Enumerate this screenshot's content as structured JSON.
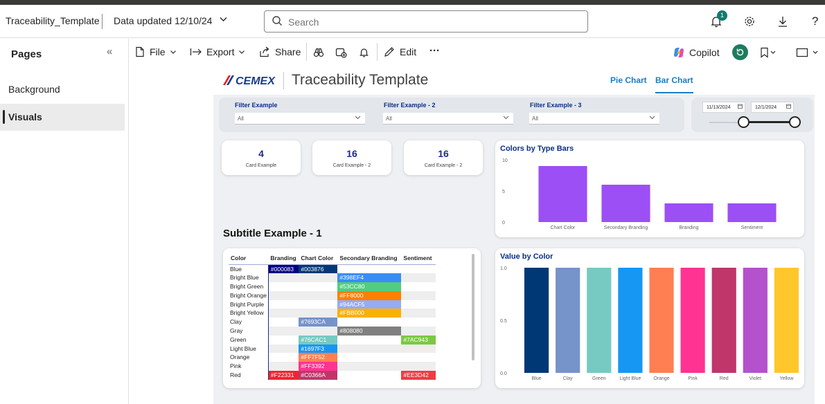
{
  "topbar": {
    "file_title": "Traceability_Template",
    "data_updated": "Data updated 12/10/24",
    "search_placeholder": "Search",
    "notification_count": "1",
    "help": "?"
  },
  "sidebar": {
    "title": "Pages",
    "collapse_glyph": "«",
    "items": [
      {
        "label": "Background",
        "active": false
      },
      {
        "label": "Visuals",
        "active": true
      }
    ]
  },
  "commandbar": {
    "file": "File",
    "export": "Export",
    "share": "Share",
    "edit": "Edit",
    "more": "···",
    "copilot": "Copilot"
  },
  "report": {
    "logo_text": "CEMEX",
    "title": "Traceability Template",
    "tabs": [
      {
        "label": "Pie Chart",
        "active": false
      },
      {
        "label": "Bar Chart",
        "active": true
      }
    ],
    "filters": [
      {
        "label": "Filter Example",
        "value": "All"
      },
      {
        "label": "Filter Example - 2",
        "value": "All"
      },
      {
        "label": "Filter Example - 3",
        "value": "All"
      }
    ],
    "date_range": {
      "start": "11/13/2024",
      "end": "12/1/2024"
    },
    "cards": [
      {
        "value": "4",
        "label": "Card Example"
      },
      {
        "value": "16",
        "label": "Card Example - 2"
      },
      {
        "value": "16",
        "label": "Card Example - 2"
      }
    ],
    "subtitle": "Subtitle Example - 1",
    "matrix": {
      "columns": [
        "Color",
        "Branding",
        "Chart Color",
        "Secondary Branding",
        "Sentiment"
      ],
      "rows": [
        {
          "label": "Blue",
          "cells": [
            "#000083",
            "#003876",
            "",
            ""
          ]
        },
        {
          "label": "Bright Blue",
          "cells": [
            "",
            "",
            "#398EF4",
            ""
          ]
        },
        {
          "label": "Bright Green",
          "cells": [
            "",
            "",
            "#53CC80",
            ""
          ]
        },
        {
          "label": "Bright Orange",
          "cells": [
            "",
            "",
            "#FF8000",
            ""
          ]
        },
        {
          "label": "Bright Purple",
          "cells": [
            "",
            "",
            "#94ACF5",
            ""
          ]
        },
        {
          "label": "Bright Yellow",
          "cells": [
            "",
            "",
            "#FBB000",
            ""
          ]
        },
        {
          "label": "Clay",
          "cells": [
            "",
            "#7693CA",
            "",
            ""
          ]
        },
        {
          "label": "Gray",
          "cells": [
            "",
            "",
            "#808080",
            ""
          ]
        },
        {
          "label": "Green",
          "cells": [
            "",
            "#76CAC1",
            "",
            "#7AC943"
          ]
        },
        {
          "label": "Light Blue",
          "cells": [
            "",
            "#1697F3",
            "",
            ""
          ]
        },
        {
          "label": "Orange",
          "cells": [
            "",
            "#FF7F52",
            "",
            ""
          ]
        },
        {
          "label": "Pink",
          "cells": [
            "",
            "#FF3392",
            "",
            ""
          ]
        },
        {
          "label": "Red",
          "cells": [
            "#F22331",
            "#C0366A",
            "",
            "#EE3D42"
          ]
        }
      ]
    }
  },
  "chart_data": [
    {
      "type": "bar",
      "title": "Colors by Type Bars",
      "categories": [
        "Chart Color",
        "Secondary Branding",
        "Branding",
        "Sentiment"
      ],
      "values": [
        9,
        6,
        3,
        3
      ],
      "ylim": [
        0,
        10
      ],
      "yticks": [
        "0",
        "5",
        "10"
      ],
      "bar_color": "#9b4ff5",
      "xlabel": "",
      "ylabel": "",
      "grid": false
    },
    {
      "type": "bar",
      "title": "Value by Color",
      "categories": [
        "Blue",
        "Clay",
        "Green",
        "Light Blue",
        "Orange",
        "Pink",
        "Red",
        "Violet",
        "Yellow"
      ],
      "values": [
        1,
        1,
        1,
        1,
        1,
        1,
        1,
        1,
        1
      ],
      "colors": [
        "#003876",
        "#7693CA",
        "#76CAC1",
        "#1697F3",
        "#FF7F52",
        "#FF3392",
        "#C0366A",
        "#B452CD",
        "#FFC72C"
      ],
      "ylim": [
        0,
        1
      ],
      "yticks": [
        "0.0",
        "0.5",
        "1.0"
      ],
      "xlabel": "",
      "ylabel": "",
      "grid": false
    }
  ]
}
